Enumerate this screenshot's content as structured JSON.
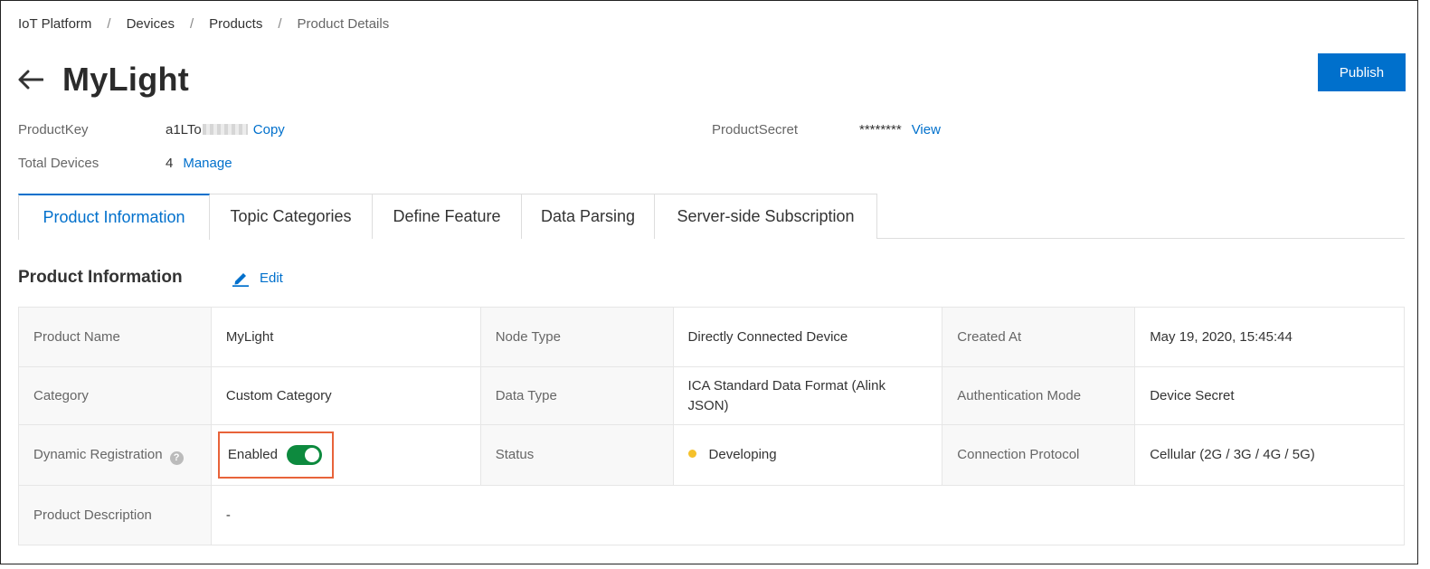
{
  "breadcrumb": [
    "IoT Platform",
    "Devices",
    "Products",
    "Product Details"
  ],
  "title": "MyLight",
  "publish_label": "Publish",
  "meta": {
    "product_key_label": "ProductKey",
    "product_key_value": "a1LTo",
    "copy_label": "Copy",
    "product_secret_label": "ProductSecret",
    "product_secret_value": "********",
    "view_label": "View",
    "total_devices_label": "Total Devices",
    "total_devices_value": "4",
    "manage_label": "Manage"
  },
  "tabs": [
    {
      "label": "Product Information",
      "active": true
    },
    {
      "label": "Topic Categories",
      "active": false
    },
    {
      "label": "Define Feature",
      "active": false
    },
    {
      "label": "Data Parsing",
      "active": false
    },
    {
      "label": "Server-side Subscription",
      "active": false
    }
  ],
  "section": {
    "title": "Product Information",
    "edit_label": "Edit",
    "edit_icon": "pencil-icon"
  },
  "info": {
    "product_name_label": "Product Name",
    "product_name": "MyLight",
    "node_type_label": "Node Type",
    "node_type": "Directly Connected Device",
    "created_at_label": "Created At",
    "created_at": "May 19, 2020, 15:45:44",
    "category_label": "Category",
    "category": "Custom Category",
    "data_type_label": "Data Type",
    "data_type": "ICA Standard Data Format (Alink JSON)",
    "auth_mode_label": "Authentication Mode",
    "auth_mode": "Device Secret",
    "dynamic_reg_label": "Dynamic Registration",
    "dynamic_reg_help": "?",
    "dynamic_reg_value": "Enabled",
    "dynamic_reg_on": true,
    "status_label": "Status",
    "status": "Developing",
    "connection_label": "Connection Protocol",
    "connection": "Cellular (2G / 3G / 4G / 5G)",
    "description_label": "Product Description",
    "description": "-"
  },
  "colors": {
    "accent": "#0070cc",
    "toggle_on": "#0d8a3e",
    "status_developing": "#f5c12b",
    "highlight_box": "#e8633a"
  }
}
